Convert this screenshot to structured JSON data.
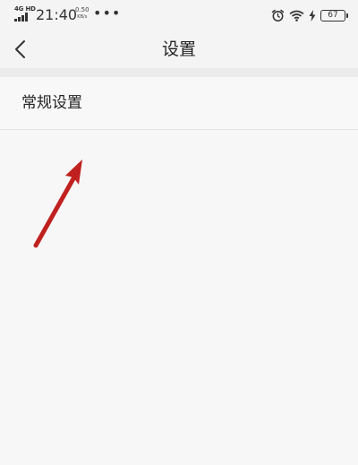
{
  "status_bar": {
    "network_type": "4G HD",
    "time": "21:40",
    "net_speed_value": "0.50",
    "net_speed_unit": "KB/s",
    "more_dots": "•••",
    "battery_level": "67",
    "icons": [
      "signal-icon",
      "alarm-icon",
      "wifi-icon",
      "charging-icon",
      "battery-icon"
    ]
  },
  "header": {
    "title": "设置",
    "back_icon": "chevron-left-icon"
  },
  "settings": {
    "items": [
      {
        "label": "常规设置"
      }
    ]
  },
  "annotation": {
    "arrow_color": "#c0211f"
  },
  "colors": {
    "background": "#f7f7f7",
    "text": "#222222"
  }
}
